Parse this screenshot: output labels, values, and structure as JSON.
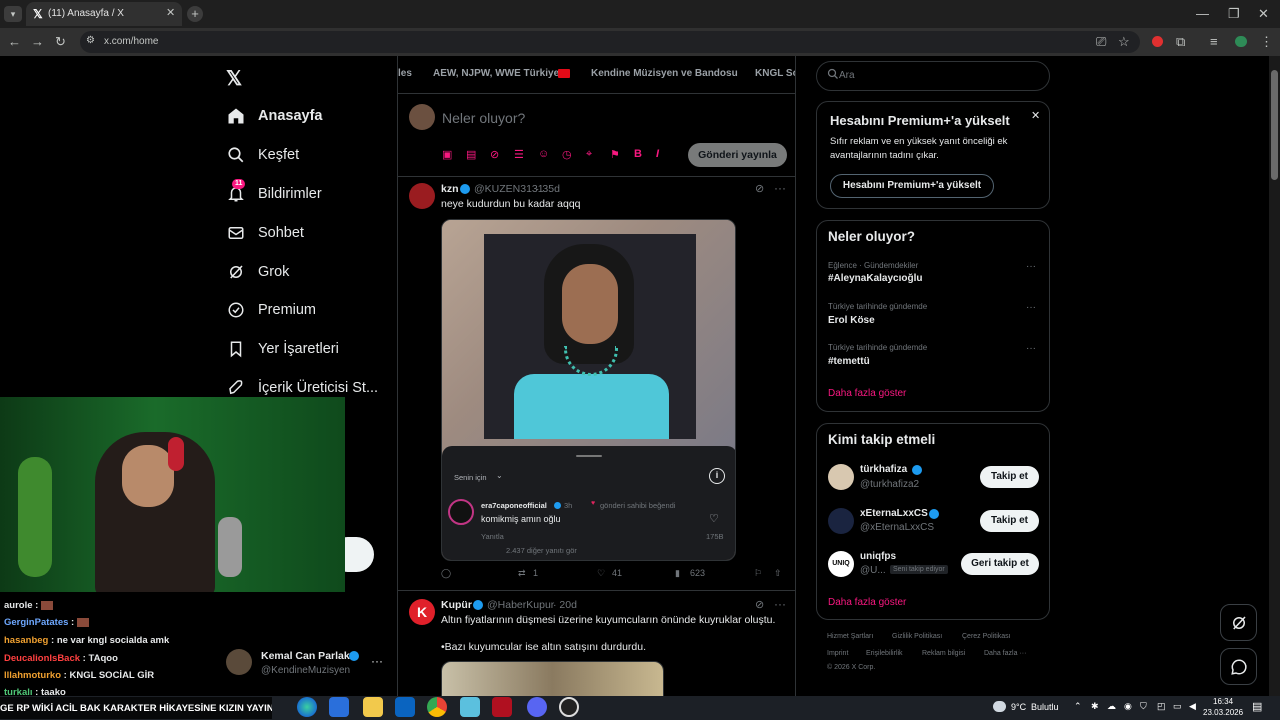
{
  "browser": {
    "tab_title": "(11) Anasayfa / X",
    "url": "x.com/home"
  },
  "sidebar": {
    "items": [
      {
        "label": "Anasayfa",
        "icon": "home-icon"
      },
      {
        "label": "Keşfet",
        "icon": "search-icon"
      },
      {
        "label": "Bildirimler",
        "icon": "bell-icon",
        "badge": "11"
      },
      {
        "label": "Sohbet",
        "icon": "mail-icon"
      },
      {
        "label": "Grok",
        "icon": "grok-icon"
      },
      {
        "label": "Premium",
        "icon": "premium-icon"
      },
      {
        "label": "Yer İşaretleri",
        "icon": "bookmark-icon"
      },
      {
        "label": "İçerik Üreticisi St...",
        "icon": "rocket-icon"
      }
    ],
    "account": {
      "name": "Kemal Can Parlak",
      "handle": "@KendineMuzisyen"
    }
  },
  "topics": [
    "les",
    "AEW, NJPW, WWE Türkiye",
    "Kendine Müzisyen ve Bandosu",
    "KNGL So"
  ],
  "composer": {
    "placeholder": "Neler oluyor?",
    "post_button": "Gönderi yayınla"
  },
  "tweets": [
    {
      "name": "kzn",
      "handle": "@KUZEN3131",
      "time": "· 35d",
      "text": "neye kudurdun bu kadar aqqq",
      "reply_sheet": {
        "sort": "Senin için",
        "user": "era7caponeofficial",
        "time": "3h",
        "liked_note": "gönderi sahibi beğendi",
        "comment": "komikmiş amın oğlu",
        "reply": "Yanıtla",
        "likes": "175B",
        "more": "2.437 diğer yanıtı gör"
      },
      "stats": {
        "retweets": "1",
        "likes": "41",
        "views": "623"
      }
    },
    {
      "name": "Kupür",
      "handle": "@HaberKupur",
      "time": "· 20d",
      "line1": "Altın fiyatlarının düşmesi üzerine kuyumcuların önünde kuyruklar oluştu.",
      "line2": "•Bazı kuyumcular ise altın satışını durdurdu."
    }
  ],
  "right": {
    "search_placeholder": "Ara",
    "premium": {
      "title": "Hesabını Premium+'a yükselt",
      "body": "Sıfır reklam ve en yüksek yanıt önceliği ek avantajlarının tadını çıkar.",
      "button": "Hesabını Premium+'a yükselt"
    },
    "trends_title": "Neler oluyor?",
    "trends": [
      {
        "context": "Eğlence · Gündemdekiler",
        "name": "#AleynaKalaycıoğlu"
      },
      {
        "context": "Türkiye tarihinde gündemde",
        "name": "Erol Köse"
      },
      {
        "context": "Türkiye tarihinde gündemde",
        "name": "#temettü"
      }
    ],
    "trends_more": "Daha fazla göster",
    "follow_title": "Kimi takip etmeli",
    "follow": [
      {
        "name": "türkhafiza",
        "handle": "@turkhafiza2",
        "button": "Takip et",
        "note": ""
      },
      {
        "name": "xEternaLxxCS",
        "handle": "@xEternaLxxCS",
        "button": "Takip et",
        "note": ""
      },
      {
        "name": "uniqfps",
        "handle": "@U...",
        "button": "Geri takip et",
        "note": "Seni takip ediyor"
      }
    ],
    "follow_more": "Daha fazla göster",
    "footer": [
      "Hizmet Şartları",
      "Gizlilik Politikası",
      "Çerez Politikası",
      "Imprint",
      "Erişilebilirlik",
      "Reklam bilgisi",
      "Daha fazla ···",
      "© 2026 X Corp."
    ]
  },
  "stream_chat": [
    {
      "user": "aurole",
      "text": "",
      "color": "#e7e9ea"
    },
    {
      "user": "GerginPatates",
      "text": "",
      "color": "#6ea8ff"
    },
    {
      "user": "hasanbeg",
      "text": "ne var kngl socialda amk",
      "color": "#f0a030"
    },
    {
      "user": "DeucalionIsBack",
      "text": "TAqoo",
      "color": "#ff4040"
    },
    {
      "user": "lllahmoturko",
      "text": "KNGL SOCİAL GİR",
      "color": "#f0a030"
    },
    {
      "user": "turkalı",
      "text": "taako",
      "color": "#50c878"
    }
  ],
  "ticker": "GE RP WİKİ ACİL BAK KARAKTER HİKAYESİNE KIZIN YAYIN",
  "taskbar": {
    "weather_temp": "9°C",
    "weather_text": "Bulutlu",
    "time": "16:34",
    "date": "23.03.2026"
  }
}
